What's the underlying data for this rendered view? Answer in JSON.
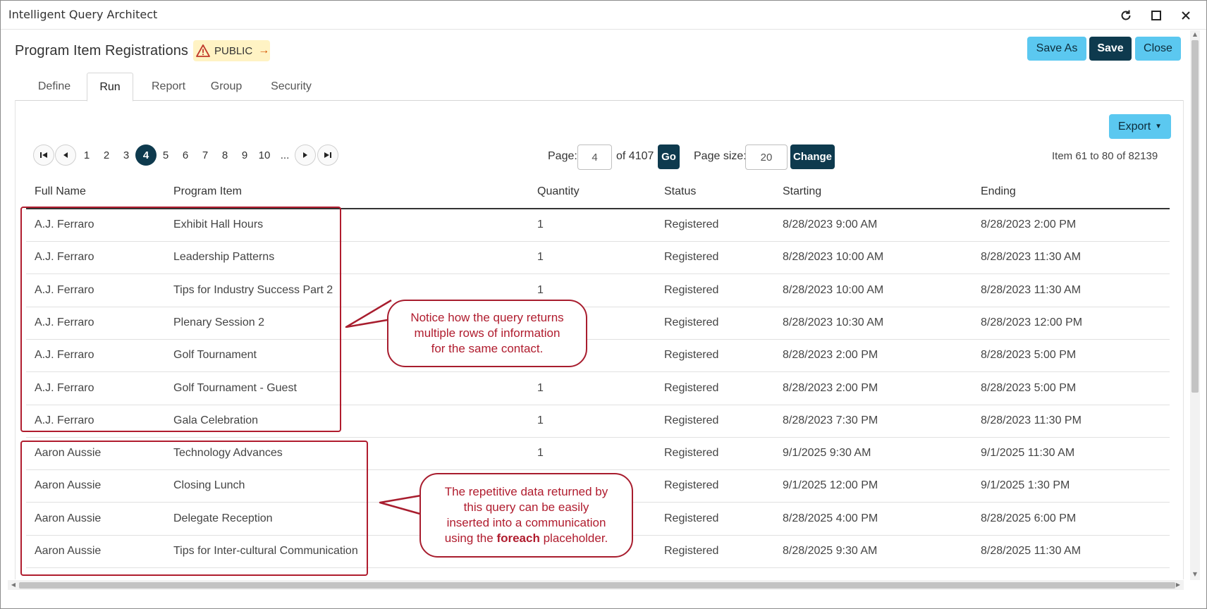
{
  "window": {
    "title": "Intelligent Query Architect"
  },
  "header": {
    "title": "Program Item Registrations",
    "badge": "PUBLIC",
    "buttons": {
      "save_as": "Save As",
      "save": "Save",
      "close": "Close"
    }
  },
  "tabs": [
    {
      "label": "Define"
    },
    {
      "label": "Run"
    },
    {
      "label": "Report"
    },
    {
      "label": "Group"
    },
    {
      "label": "Security"
    }
  ],
  "export": {
    "label": "Export"
  },
  "pager": {
    "pages": [
      "1",
      "2",
      "3",
      "4",
      "5",
      "6",
      "7",
      "8",
      "9",
      "10",
      "..."
    ],
    "current_page": "4",
    "page_label": "Page:",
    "page_value": "4",
    "of_total": "of 4107",
    "go": "Go",
    "size_label": "Page size:",
    "size_value": "20",
    "change": "Change",
    "range_prefix": "Item",
    "range_from": "61",
    "range_to_word": "to",
    "range_to": "80",
    "range_of_word": "of",
    "range_total": "82139"
  },
  "table": {
    "columns": [
      "Full Name",
      "Program Item",
      "Quantity",
      "Status",
      "Starting",
      "Ending"
    ],
    "rows": [
      [
        "A.J. Ferraro",
        "Exhibit Hall Hours",
        "1",
        "Registered",
        "8/28/2023 9:00 AM",
        "8/28/2023 2:00 PM"
      ],
      [
        "A.J. Ferraro",
        "Leadership Patterns",
        "1",
        "Registered",
        "8/28/2023 10:00 AM",
        "8/28/2023 11:30 AM"
      ],
      [
        "A.J. Ferraro",
        "Tips for Industry Success Part 2",
        "1",
        "Registered",
        "8/28/2023 10:00 AM",
        "8/28/2023 11:30 AM"
      ],
      [
        "A.J. Ferraro",
        "Plenary Session 2",
        "",
        "Registered",
        "8/28/2023 10:30 AM",
        "8/28/2023 12:00 PM"
      ],
      [
        "A.J. Ferraro",
        "Golf Tournament",
        "",
        "Registered",
        "8/28/2023 2:00 PM",
        "8/28/2023 5:00 PM"
      ],
      [
        "A.J. Ferraro",
        "Golf Tournament - Guest",
        "1",
        "Registered",
        "8/28/2023 2:00 PM",
        "8/28/2023 5:00 PM"
      ],
      [
        "A.J. Ferraro",
        "Gala Celebration",
        "1",
        "Registered",
        "8/28/2023 7:30 PM",
        "8/28/2023 11:30 PM"
      ],
      [
        "Aaron Aussie",
        "Technology Advances",
        "1",
        "Registered",
        "9/1/2025 9:30 AM",
        "9/1/2025 11:30 AM"
      ],
      [
        "Aaron Aussie",
        "Closing Lunch",
        "",
        "Registered",
        "9/1/2025 12:00 PM",
        "9/1/2025 1:30 PM"
      ],
      [
        "Aaron Aussie",
        "Delegate Reception",
        "",
        "Registered",
        "8/28/2025 4:00 PM",
        "8/28/2025 6:00 PM"
      ],
      [
        "Aaron Aussie",
        "Tips for Inter-cultural Communication",
        "",
        "Registered",
        "8/28/2025 9:30 AM",
        "8/28/2025 11:30 AM"
      ]
    ]
  },
  "callouts": {
    "first": [
      "Notice how the query returns",
      "multiple rows of information",
      "for the same contact."
    ],
    "second": {
      "line1": "The repetitive data returned by",
      "line2": "this query can be easily",
      "line3": "inserted into a communication",
      "line4_pre": "using the",
      "line4_bold": "foreach",
      "line4_post": "placeholder."
    }
  },
  "colors": {
    "accent_light": "#5bc8f0",
    "accent_dark": "#0e3a4e",
    "annotation": "#b01c2e",
    "badge_bg": "#fff3c4"
  }
}
